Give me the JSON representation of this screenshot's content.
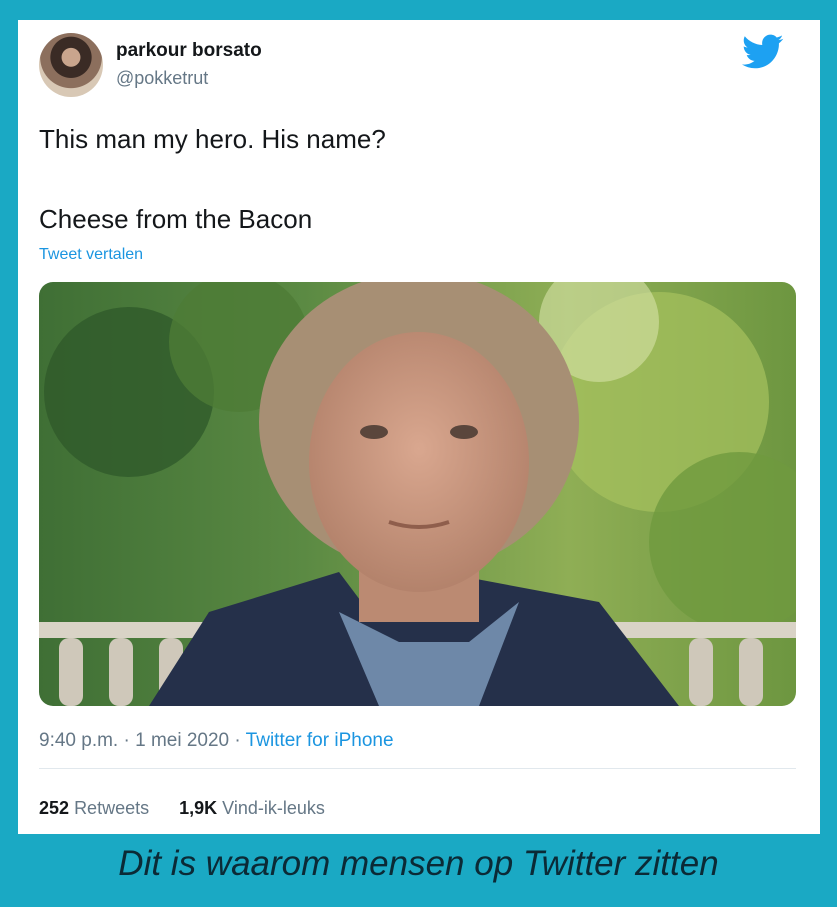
{
  "tweet": {
    "display_name": "parkour borsato",
    "handle": "@pokketrut",
    "text_line1": "This man my hero. His name?",
    "text_line2": "Cheese from the Bacon",
    "translate_link": "Tweet vertalen",
    "time": "9:40 p.m.",
    "sep1": " · ",
    "date": "1 mei 2020",
    "sep2": " · ",
    "source": "Twitter for iPhone",
    "retweets_count": "252",
    "retweets_label": "Retweets",
    "likes_count": "1,9K",
    "likes_label": "Vind-ik-leuks",
    "logo_icon": "twitter-bird-icon"
  },
  "caption": "Dit is waarom mensen op Twitter zitten",
  "colors": {
    "frame": "#1aa9c4",
    "twitter_blue": "#1b95e0",
    "muted": "#657786",
    "text": "#14171a"
  }
}
